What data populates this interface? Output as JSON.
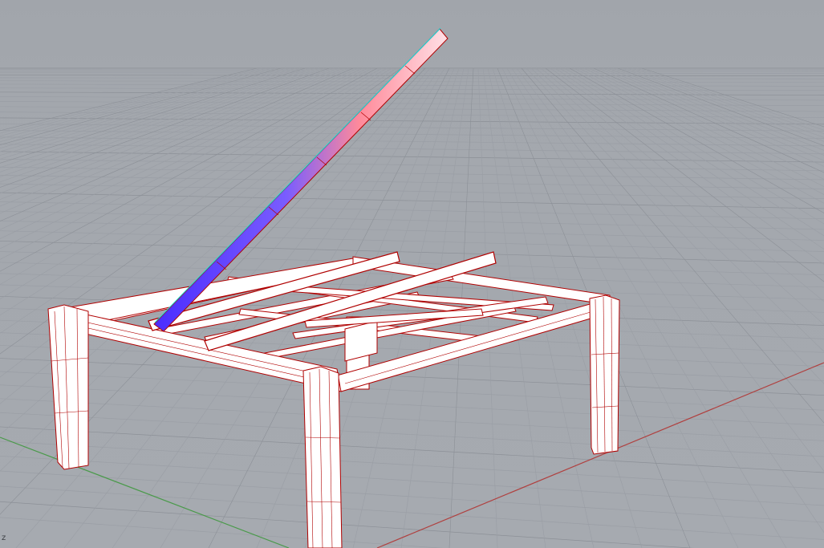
{
  "viewport": {
    "axis_indicator": "z",
    "colors": {
      "background": "#a4a8af",
      "grid_minor": "#9a9ea5",
      "grid_major": "#8c9097",
      "x_axis": "#b0403f",
      "y_axis": "#4a9a4a",
      "wire": "#b00000",
      "solid_fill": "#ffffff",
      "selected_highlight": "#6a4cff"
    }
  }
}
